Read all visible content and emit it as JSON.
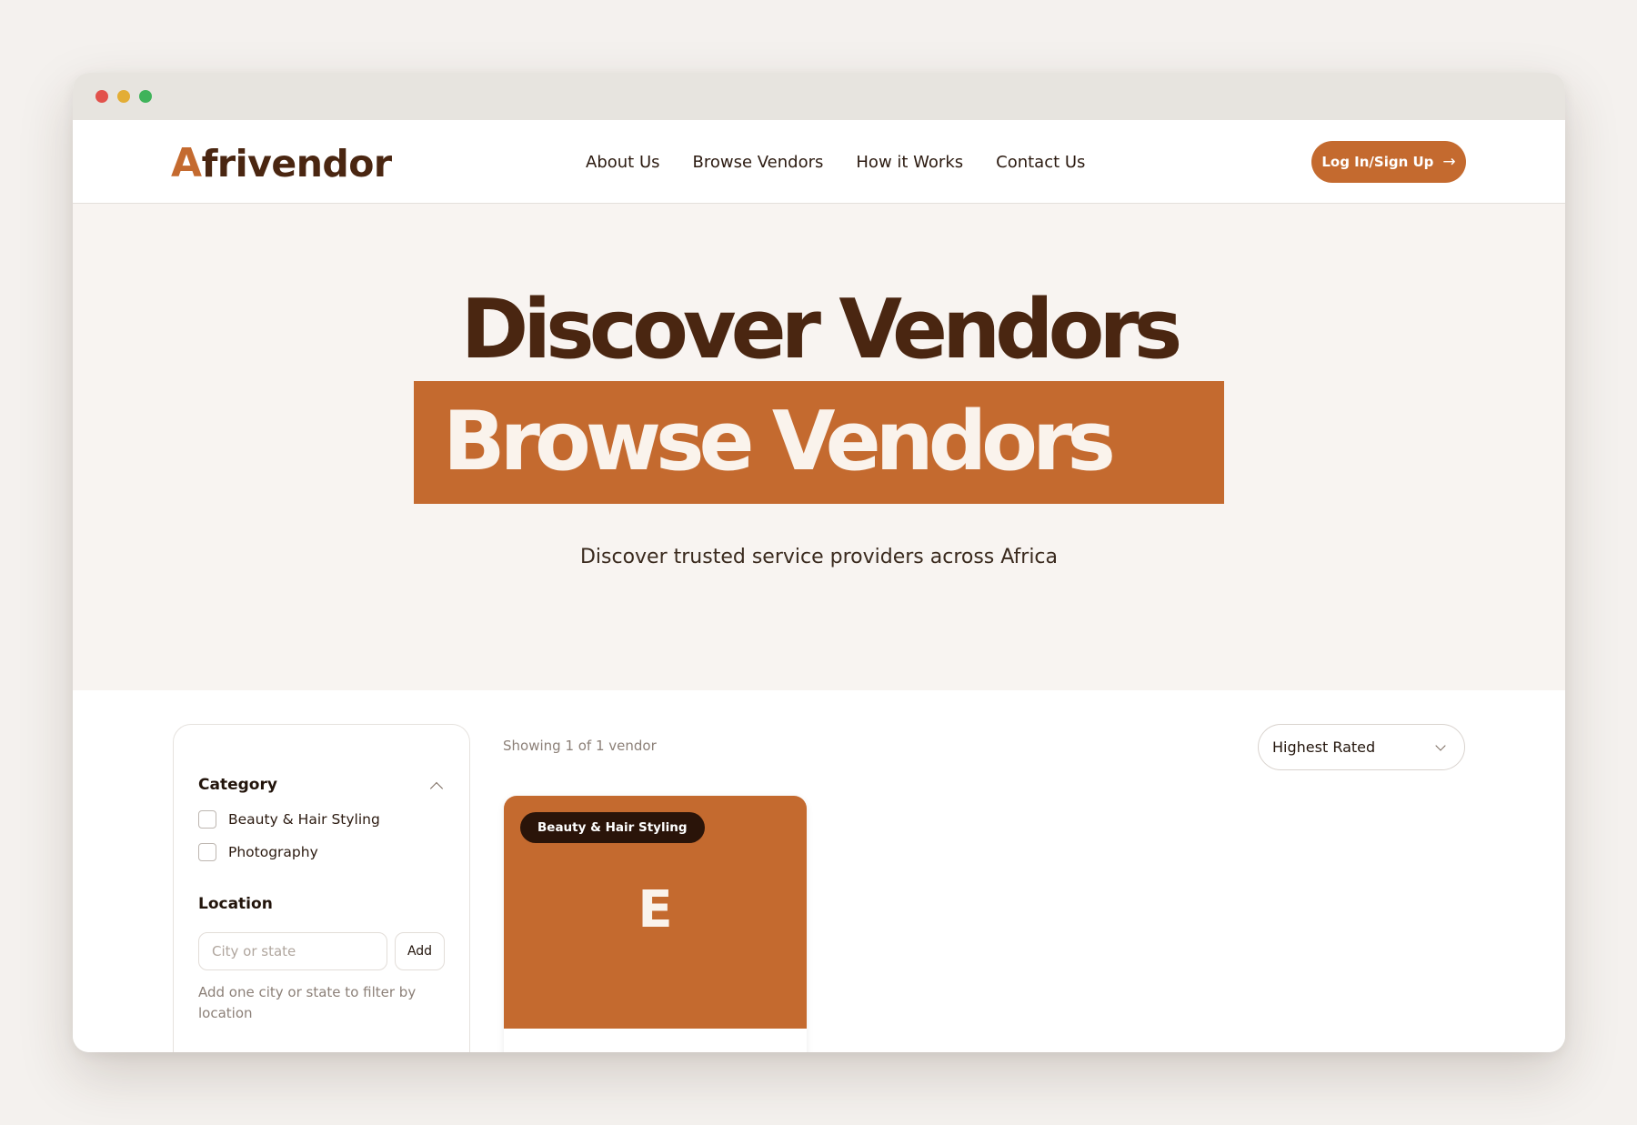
{
  "brand": {
    "name_initial": "A",
    "name_rest": "frivendor",
    "accent_color": "#c46a2f",
    "dark_color": "#4a2611"
  },
  "nav": {
    "links": [
      "About Us",
      "Browse Vendors",
      "How it Works",
      "Contact Us"
    ],
    "login_label": "Log In/Sign Up",
    "login_icon": "arrow-right-icon"
  },
  "hero": {
    "title": "Discover Vendors",
    "banner_text": "Browse Vendors",
    "subtitle": "Discover trusted service providers across Africa"
  },
  "filters": {
    "category_heading": "Category",
    "categories": [
      "Beauty & Hair Styling",
      "Photography"
    ],
    "location_heading": "Location",
    "location_placeholder": "City or state",
    "location_value": "",
    "add_label": "Add",
    "location_hint": "Add one city or state to filter by location"
  },
  "results": {
    "showing_text": "Showing 1 of 1 vendor",
    "sort_value": "Highest Rated"
  },
  "vendors": [
    {
      "category_badge": "Beauty & Hair Styling",
      "initial": "E"
    }
  ]
}
